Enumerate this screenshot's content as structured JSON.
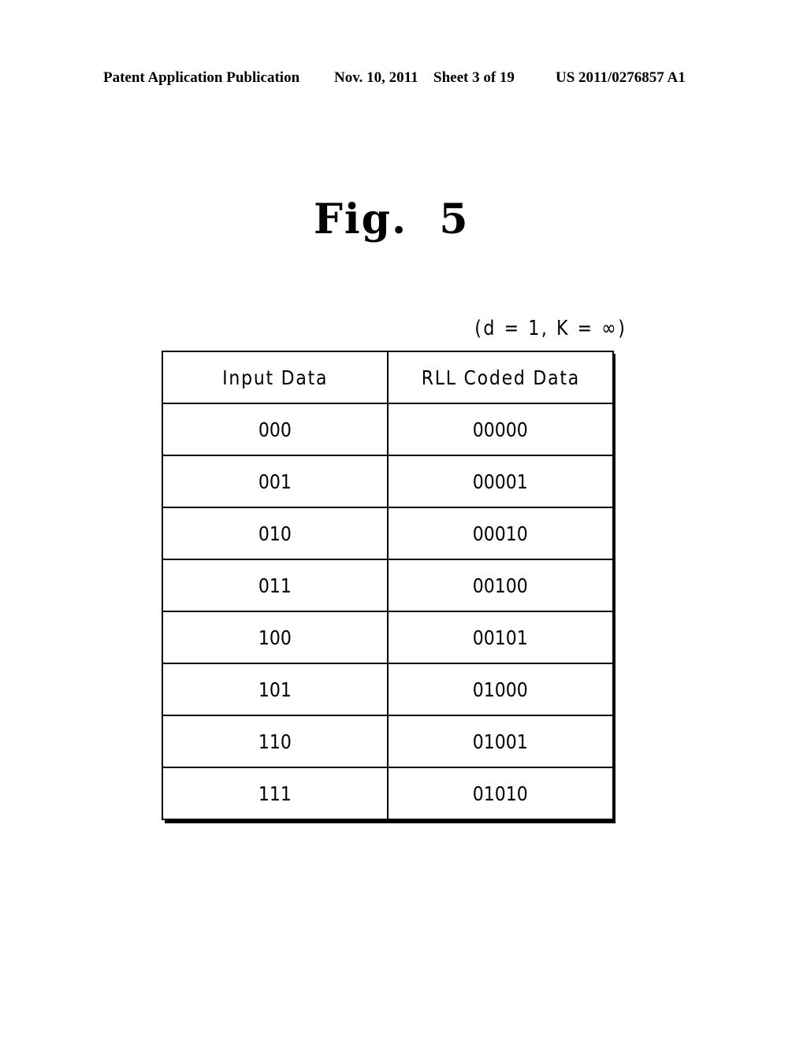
{
  "header": {
    "publication": "Patent Application Publication",
    "date": "Nov. 10, 2011",
    "sheet": "Sheet 3 of 19",
    "patent_number": "US 2011/0276857 A1"
  },
  "figure": {
    "title": "Fig.  5",
    "parameters": "(d = 1, K = ∞)"
  },
  "table": {
    "headers": [
      "Input Data",
      "RLL Coded Data"
    ],
    "rows": [
      [
        "000",
        "00000"
      ],
      [
        "001",
        "00001"
      ],
      [
        "010",
        "00010"
      ],
      [
        "011",
        "00100"
      ],
      [
        "100",
        "00101"
      ],
      [
        "101",
        "01000"
      ],
      [
        "110",
        "01001"
      ],
      [
        "111",
        "01010"
      ]
    ]
  }
}
